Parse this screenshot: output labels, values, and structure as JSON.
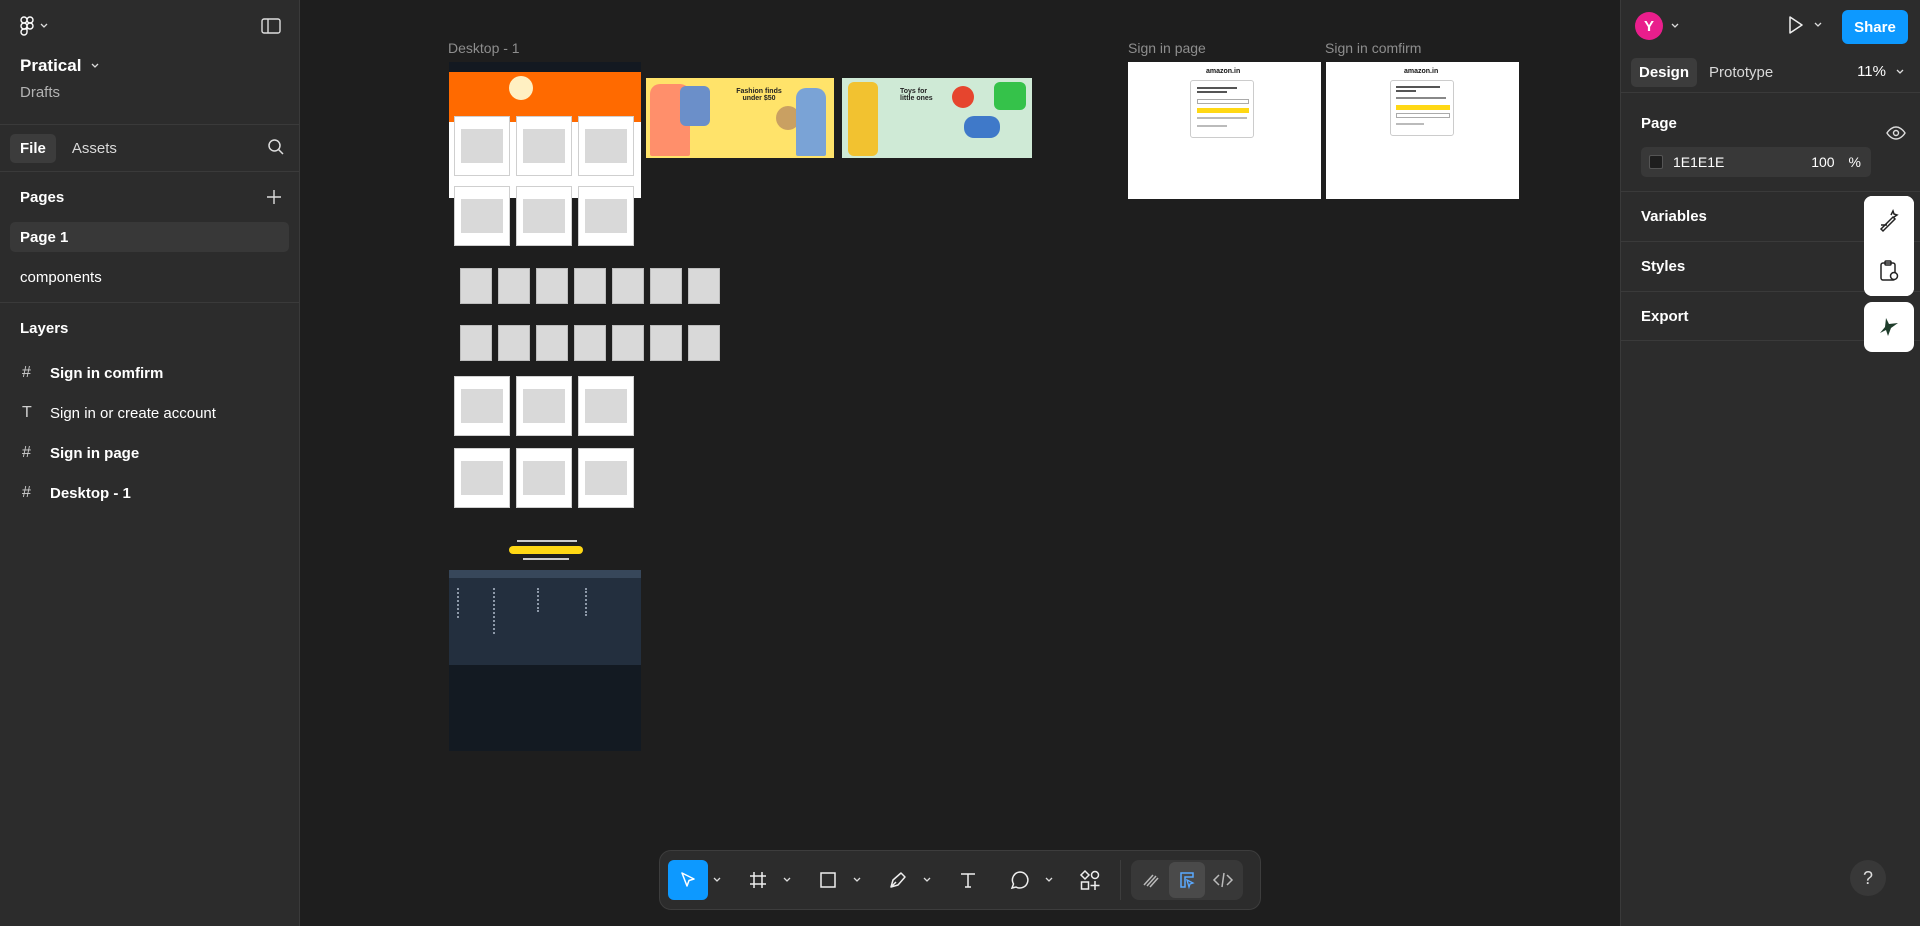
{
  "app": {
    "project_name": "Pratical",
    "project_location": "Drafts"
  },
  "left_panel": {
    "tabs": [
      {
        "label": "File"
      },
      {
        "label": "Assets"
      }
    ],
    "pages_title": "Pages",
    "pages": [
      {
        "label": "Page 1"
      },
      {
        "label": "components"
      }
    ],
    "layers_title": "Layers",
    "layers": [
      {
        "label": "Sign in comfirm",
        "icon": "frame-icon"
      },
      {
        "label": "Sign in or create account",
        "icon": "text-icon"
      },
      {
        "label": "Sign in page",
        "icon": "frame-icon"
      },
      {
        "label": "Desktop - 1",
        "icon": "frame-icon"
      }
    ]
  },
  "canvas": {
    "frames": [
      {
        "label": "Desktop - 1"
      },
      {
        "label": "Sign in page"
      },
      {
        "label": "Sign in comfirm"
      }
    ],
    "mock": {
      "banner_text_1": "Fashion finds under $50",
      "banner_text_2": "Toys for little ones",
      "logo": "amazon.in"
    }
  },
  "right_panel": {
    "avatar_letter": "Y",
    "share_label": "Share",
    "tabs": [
      {
        "label": "Design"
      },
      {
        "label": "Prototype"
      }
    ],
    "zoom": "11%",
    "page_title": "Page",
    "page_color": "1E1E1E",
    "page_opacity": "100",
    "percent": "%",
    "sections": [
      {
        "label": "Variables"
      },
      {
        "label": "Styles"
      },
      {
        "label": "Export"
      }
    ],
    "help": "?"
  },
  "colors": {
    "accent": "#0d99ff",
    "canvas_bg": "#1e1e1e",
    "panel_bg": "#2c2c2c",
    "avatar": "#e91e8c",
    "amazon_orange": "#ff6a00",
    "sign_in_yellow": "#ffd814"
  }
}
